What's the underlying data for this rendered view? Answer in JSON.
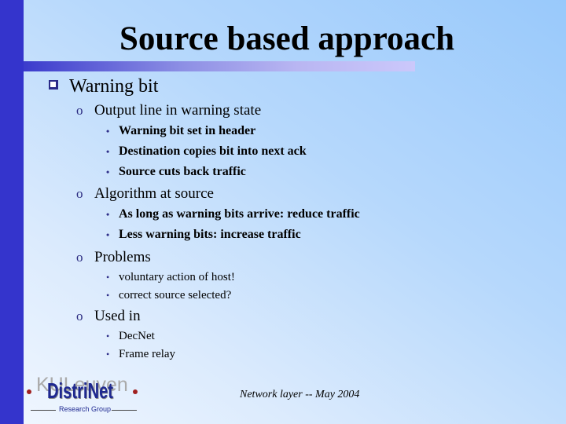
{
  "slide": {
    "title": "Source based approach",
    "bullets": [
      {
        "label": "Warning bit",
        "children": [
          {
            "label": "Output line in warning state",
            "children": [
              "Warning bit set in header",
              "Destination copies bit into next ack",
              "Source cuts back traffic"
            ]
          },
          {
            "label": "Algorithm at source",
            "children": [
              "As long as warning bits arrive: reduce traffic",
              "Less warning bits: increase traffic"
            ]
          },
          {
            "label": "Problems",
            "children": [
              "voluntary action of host!",
              "correct source selected?"
            ]
          },
          {
            "label": "Used in",
            "children": [
              "DecNet",
              "Frame relay"
            ]
          }
        ]
      }
    ],
    "bullet_glyphs": {
      "level2": "o",
      "level3": "•"
    },
    "footer": "Network layer -- May 2004",
    "logo": {
      "watermark": "KULeuven",
      "name": "DistriNet",
      "subtitle": "Research Group"
    }
  },
  "colors": {
    "left_bar": "#3434cc",
    "title_rule_start": "#3b3bcc",
    "title_rule_end": "#cbc8fb",
    "background_light": "#f1f7ff",
    "background_dark": "#99c9fb",
    "logo_text": "#1e2890"
  }
}
